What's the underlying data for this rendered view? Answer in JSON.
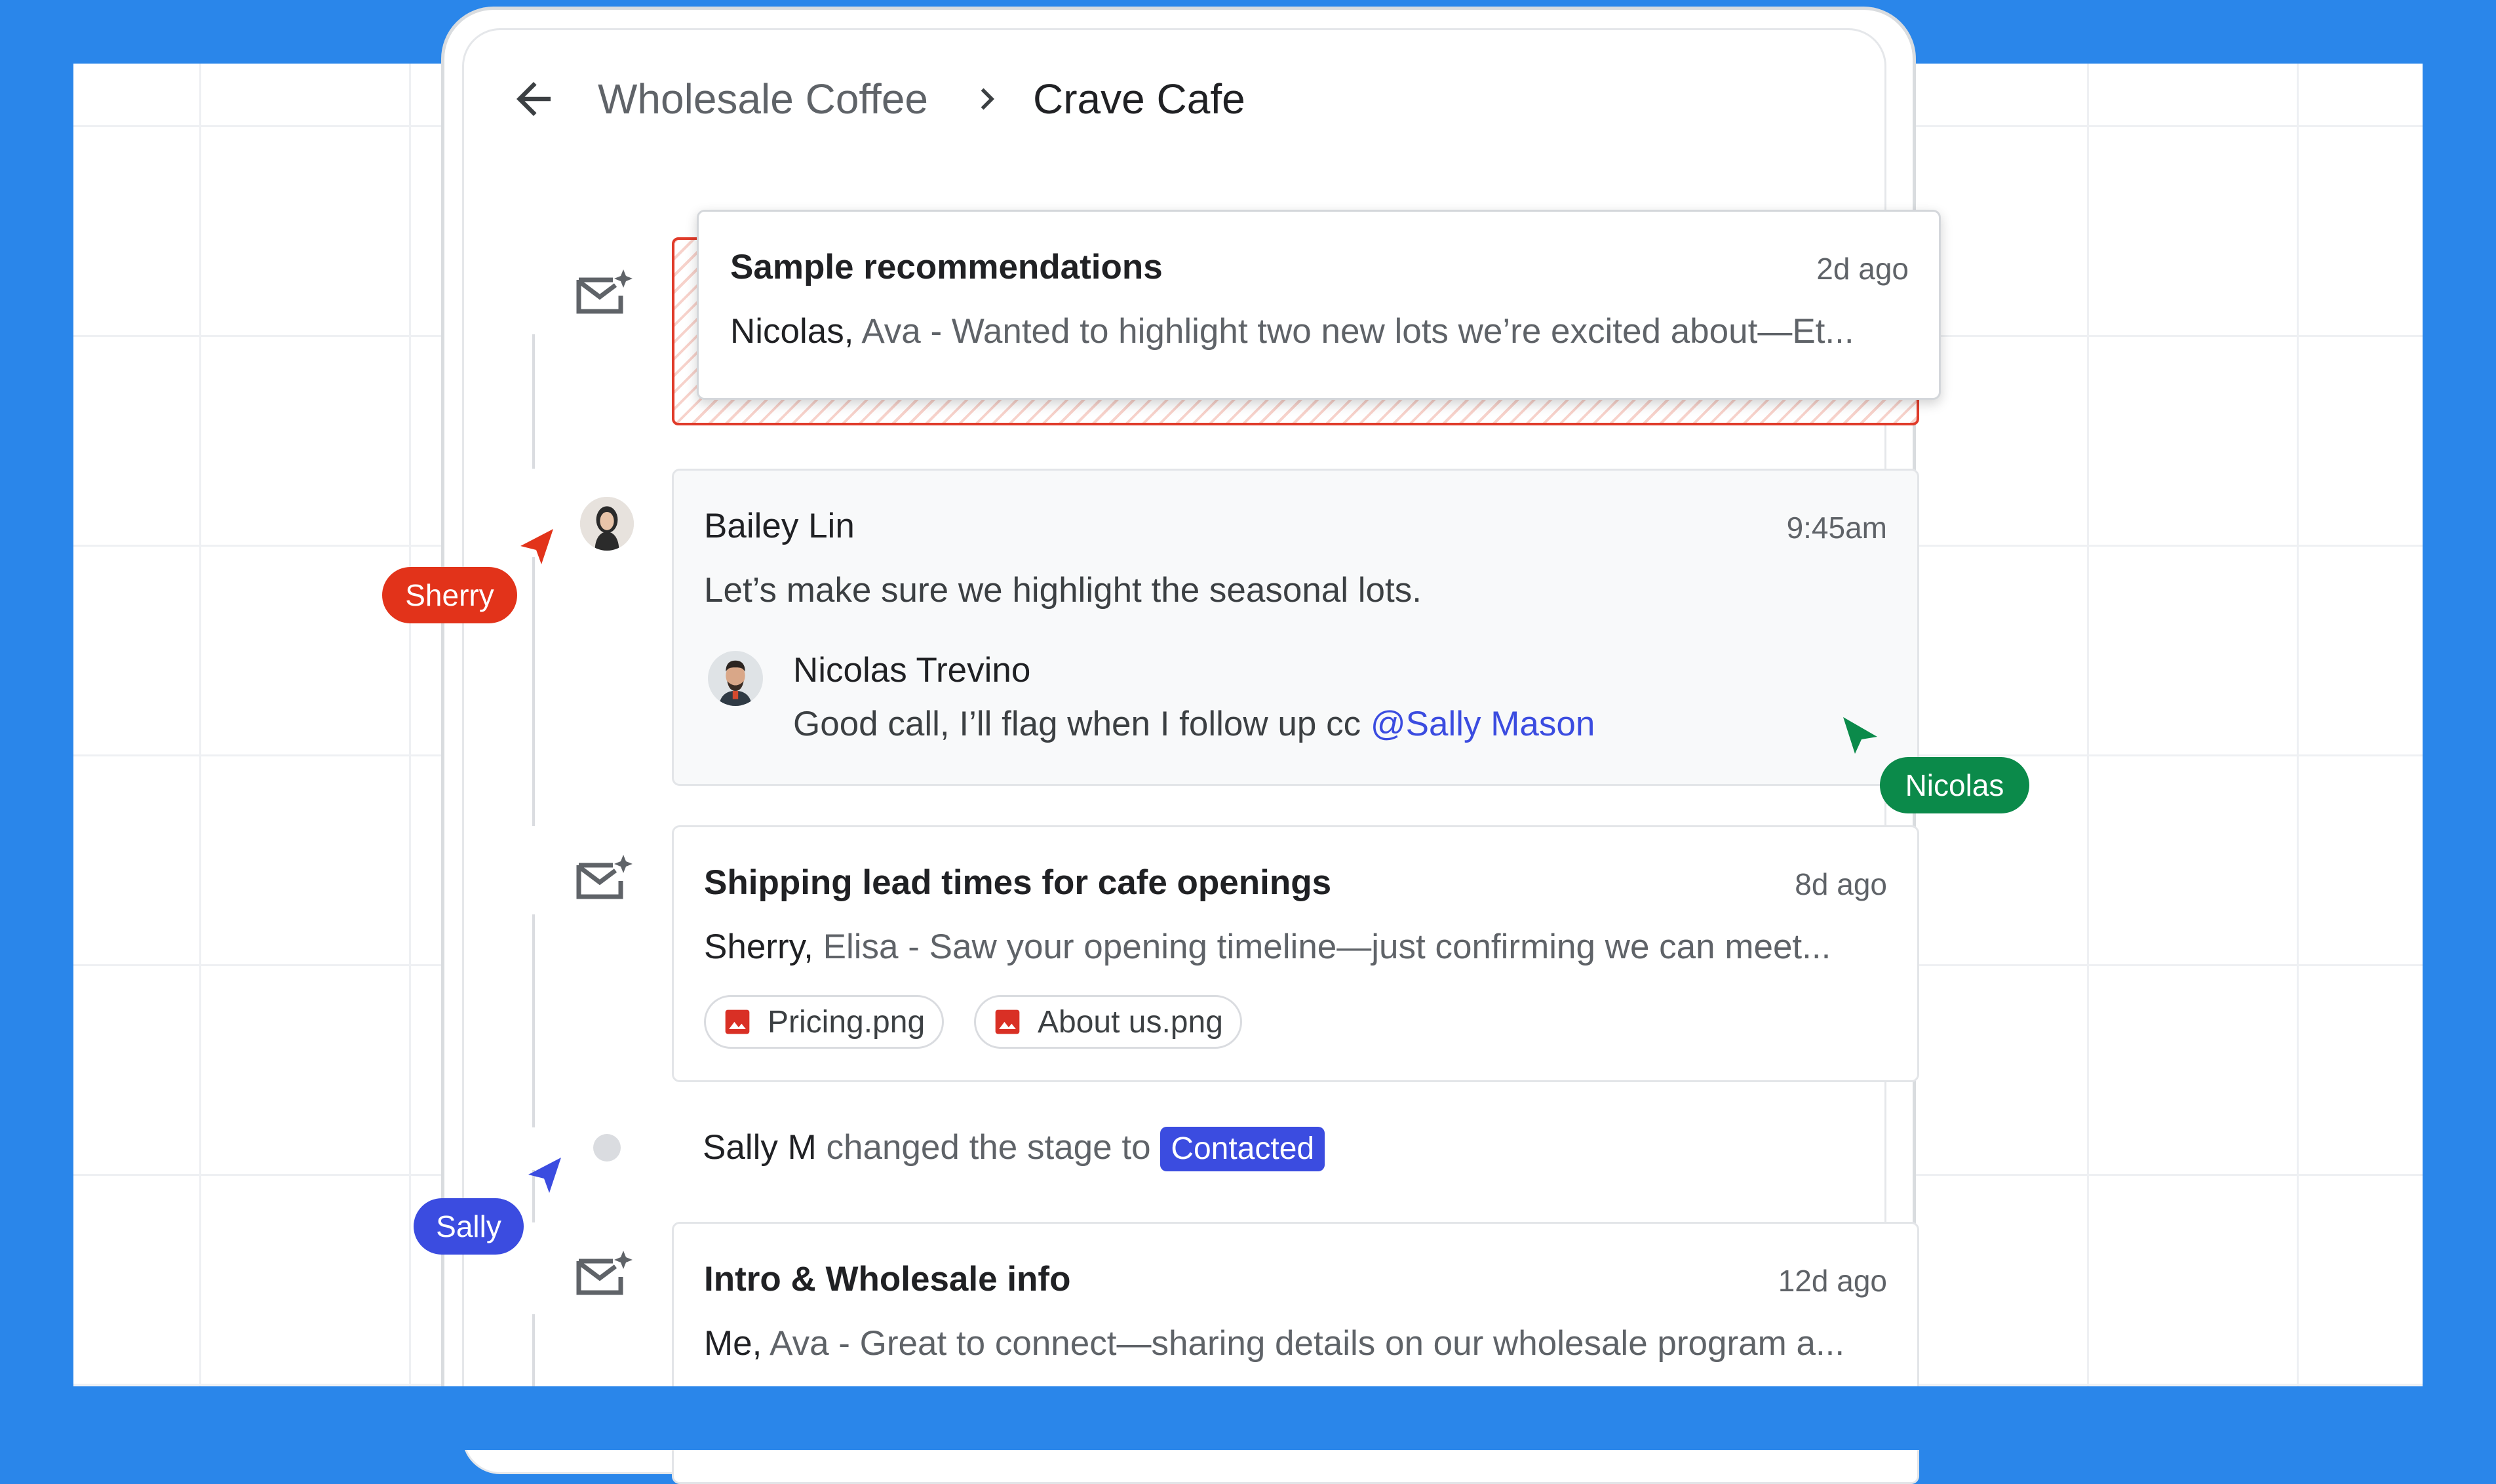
{
  "header": {
    "breadcrumb_1": "Wholesale Coffee",
    "breadcrumb_2": "Crave Cafe"
  },
  "timeline": {
    "email_1": {
      "title": "Sample recommendations",
      "time": "2d ago",
      "sender_primary": "Nicolas,",
      "sender_secondary": "Ava",
      "snippet": "- Wanted to highlight two new lots we’re excited about—Et..."
    },
    "comment": {
      "author": "Bailey Lin",
      "time": "9:45am",
      "text": "Let’s make sure we highlight the seasonal lots.",
      "reply_author": "Nicolas Trevino",
      "reply_text": "Good call, I’ll flag when I follow up cc",
      "reply_mention": "@Sally Mason"
    },
    "email_2": {
      "title": "Shipping lead times for cafe openings",
      "time": "8d ago",
      "sender_primary": "Sherry,",
      "sender_secondary": "Elisa",
      "snippet": "- Saw your opening timeline—just confirming we can meet...",
      "attachments": [
        "Pricing.png",
        "About us.png"
      ]
    },
    "stage_change": {
      "actor": "Sally M",
      "text": "changed the stage to",
      "stage": "Contacted"
    },
    "email_3": {
      "title": "Intro & Wholesale info",
      "time": "12d ago",
      "sender_primary": "Me,",
      "sender_secondary": "Ava",
      "snippet": "- Great to connect—sharing details on our wholesale program a..."
    }
  },
  "cursors": {
    "sherry": {
      "name": "Sherry",
      "color": "#e2331a"
    },
    "nicolas": {
      "name": "Nicolas",
      "color": "#0b8a4a"
    },
    "sally": {
      "name": "Sally",
      "color": "#3b4ce0"
    }
  },
  "colors": {
    "background": "#2a86ea",
    "mention": "#3b4ce0",
    "highlight_border": "#e03b2a"
  }
}
